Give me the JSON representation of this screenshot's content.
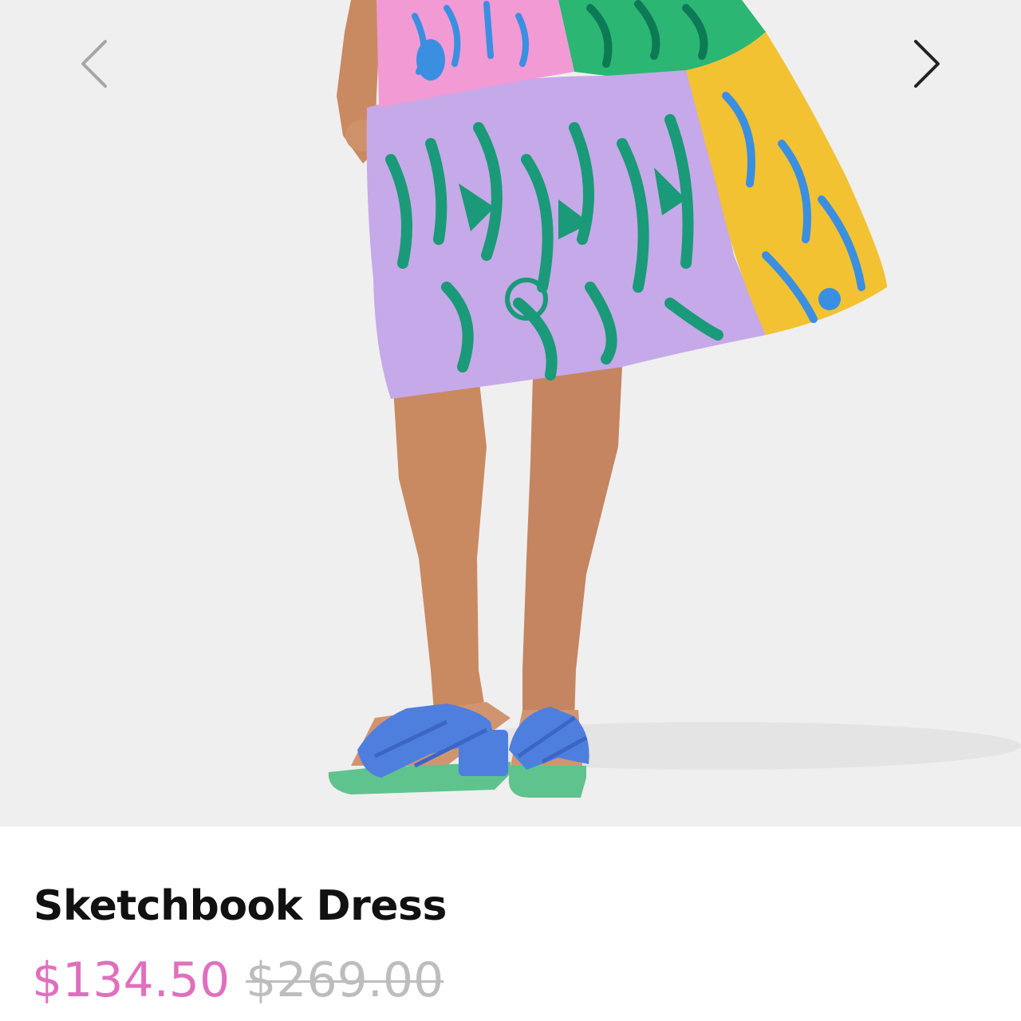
{
  "gallery": {
    "image_alt": "Model wearing a colorful printed tiered dress with blue slide sandals",
    "prev_icon": "chevron-left-icon",
    "next_icon": "chevron-right-icon",
    "colors": {
      "background": "#efefef",
      "skirt_lilac": "#c6a9e8",
      "print_green": "#1a9a78",
      "bodice_pink": "#f29ad4",
      "panel_green": "#2bb673",
      "panel_yellow": "#f2c233",
      "print_blue": "#3a8fe0",
      "sandal_blue": "#4f7fde",
      "sole_green": "#5fc38d",
      "skin": "#c98a61"
    }
  },
  "product": {
    "name": "Sketchbook Dress",
    "sale_price": "$134.50",
    "original_price": "$269.00",
    "colors": {
      "sale": "#e06fbe",
      "original": "#bdbdbd",
      "name": "#111111"
    }
  }
}
